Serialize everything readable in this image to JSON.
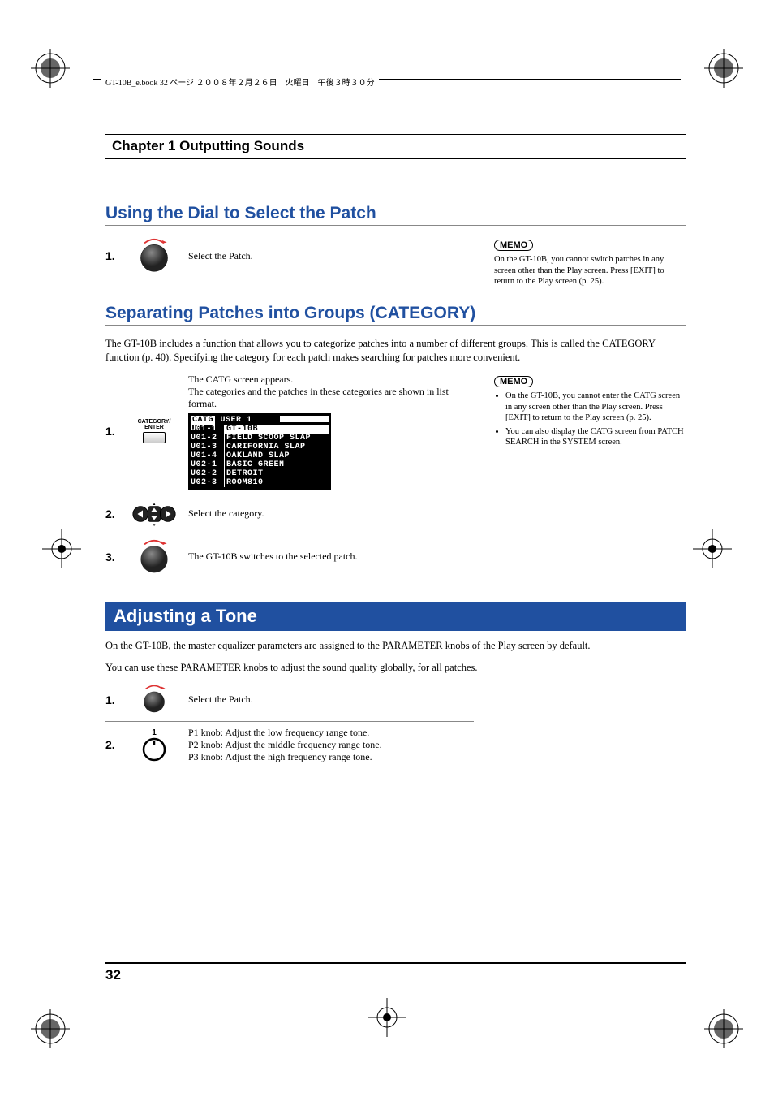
{
  "page_header": "GT-10B_e.book 32 ページ ２００８年２月２６日　火曜日　午後３時３０分",
  "chapter_title": "Chapter 1 Outputting Sounds",
  "section1": {
    "title": "Using the Dial to Select the Patch",
    "step1_num": "1.",
    "step1_text": "Select the Patch.",
    "memo_label": "MEMO",
    "memo_text": "On the GT-10B, you cannot switch patches in any screen other than the Play screen. Press [EXIT] to return to the Play screen (p. 25)."
  },
  "section2": {
    "title": "Separating Patches into Groups (CATEGORY)",
    "intro": "The GT-10B includes a function that allows you to categorize patches into a number of different groups. This is called the CATEGORY function (p. 40). Specifying the category for each patch makes searching for patches more convenient.",
    "step1_num": "1.",
    "step1_text": "The CATG screen appears.\nThe categories and the patches in these categories are shown in list format.",
    "button_label": "CATEGORY/\nENTER",
    "lcd": {
      "header_left": "CATG",
      "header_right": "USER 1",
      "rows": [
        {
          "id": "U01-1",
          "name": "GT-10B",
          "inverted": true
        },
        {
          "id": "U01-2",
          "name": "FIELD SCOOP SLAP",
          "inverted": false
        },
        {
          "id": "U01-3",
          "name": "CARIFORNIA SLAP",
          "inverted": false
        },
        {
          "id": "U01-4",
          "name": "OAKLAND SLAP",
          "inverted": false
        },
        {
          "id": "U02-1",
          "name": "BASIC GREEN",
          "inverted": false
        },
        {
          "id": "U02-2",
          "name": "DETROIT",
          "inverted": false
        },
        {
          "id": "U02-3",
          "name": "ROOM810",
          "inverted": false
        }
      ]
    },
    "memo_label": "MEMO",
    "memo1": "On the GT-10B, you cannot enter the CATG screen in any screen other than the Play screen. Press [EXIT] to return to the Play screen (p. 25).",
    "memo2": "You can also display the CATG screen from PATCH SEARCH in the SYSTEM screen.",
    "step2_num": "2.",
    "step2_text": "Select the category.",
    "step3_num": "3.",
    "step3_text": "The GT-10B switches to the selected patch."
  },
  "section3": {
    "title": "Adjusting a Tone",
    "intro1": "On the GT-10B, the master equalizer parameters are assigned to the PARAMETER knobs of the Play screen by default.",
    "intro2": "You can use these PARAMETER knobs to adjust the sound quality globally, for all patches.",
    "step1_num": "1.",
    "step1_text": "Select the Patch.",
    "step2_num": "2.",
    "knob_label": "1",
    "step2_text": "P1 knob: Adjust the low frequency range tone.\nP2 knob: Adjust the middle frequency range tone.\nP3 knob: Adjust the high frequency range tone."
  },
  "page_number": "32"
}
